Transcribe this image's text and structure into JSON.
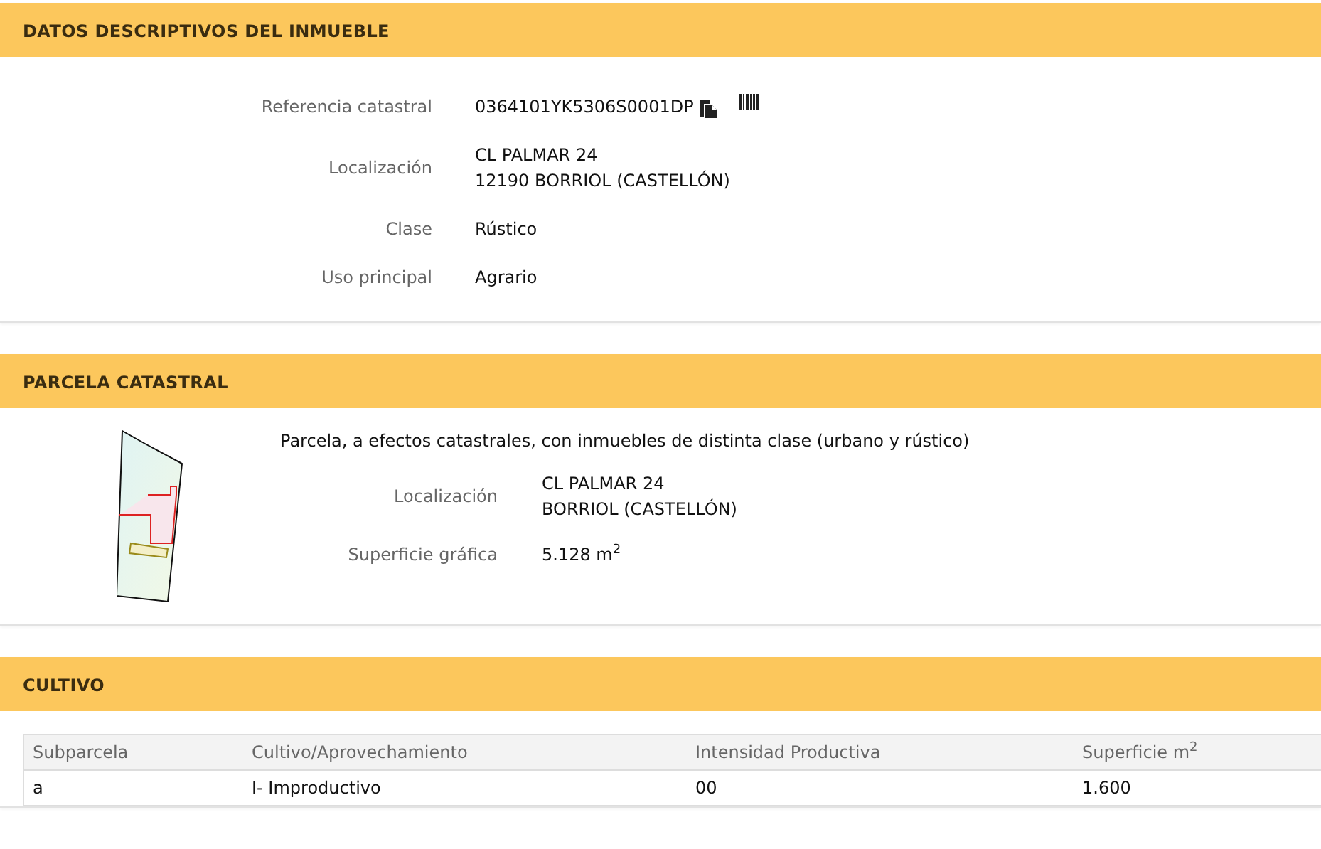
{
  "sections": [
    {
      "kind": "fields",
      "title": "DATOS DESCRIPTIVOS DEL INMUEBLE",
      "fields": [
        {
          "label": "Referencia catastral",
          "lines": [
            "0364101YK5306S0001DP"
          ],
          "actions": true
        },
        {
          "label": "Localización",
          "lines": [
            "CL PALMAR 24",
            "12190 BORRIOL (CASTELLÓN)"
          ]
        },
        {
          "label": "Clase",
          "lines": [
            "Rústico"
          ]
        },
        {
          "label": "Uso principal",
          "lines": [
            "Agrario"
          ]
        }
      ]
    },
    {
      "kind": "parcel",
      "title": "PARCELA CATASTRAL",
      "description": "Parcela, a efectos catastrales, con inmuebles de distinta clase (urbano y rústico)",
      "fields": [
        {
          "label": "Localización",
          "lines": [
            "CL PALMAR 24",
            "BORRIOL (CASTELLÓN)"
          ]
        },
        {
          "label": "Superficie gráfica",
          "lines": [
            "5.128 m$^{2}$"
          ]
        }
      ]
    },
    {
      "kind": "table",
      "title": "CULTIVO",
      "columns": [
        "Subparcela",
        "Cultivo/Aprovechamiento",
        "Intensidad Productiva",
        "Superficie m$^{2}$"
      ],
      "rows": [
        [
          "a",
          "I- Improductivo",
          "00",
          "1.600"
        ]
      ]
    }
  ]
}
